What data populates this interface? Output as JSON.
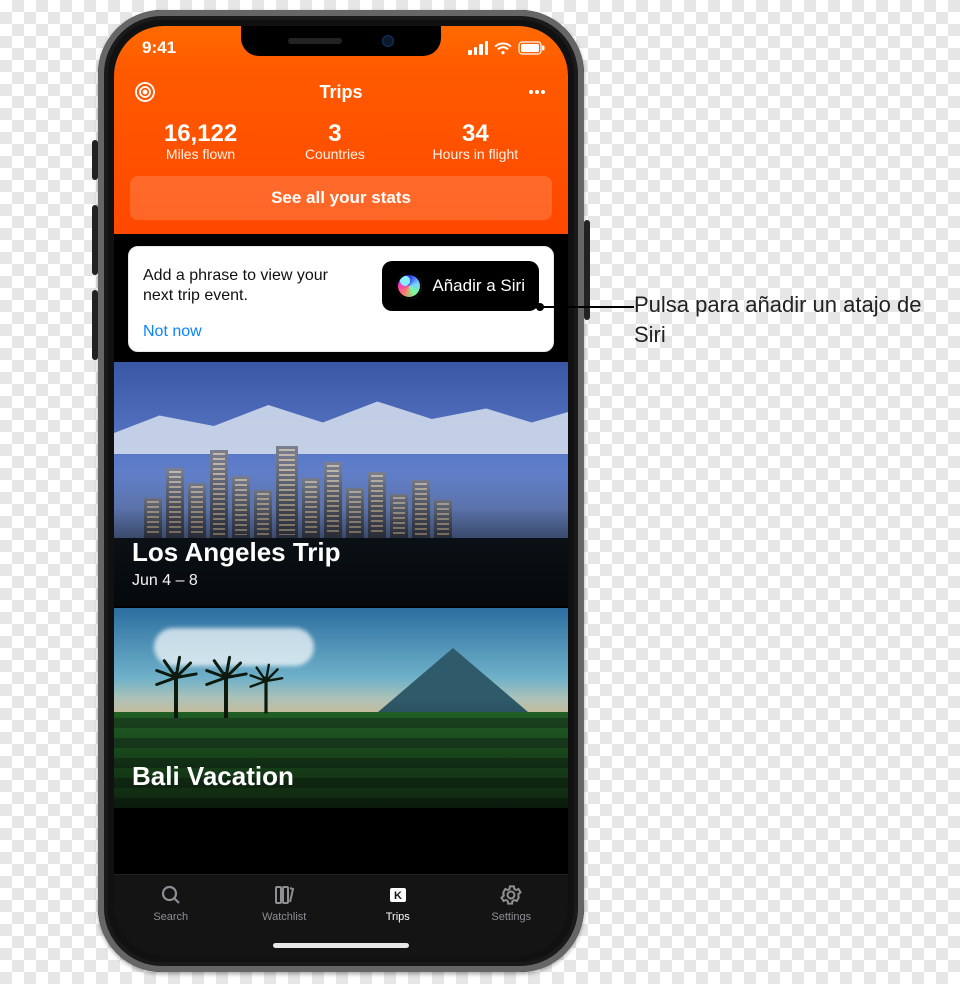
{
  "status": {
    "time": "9:41"
  },
  "nav": {
    "title": "Trips"
  },
  "stats": {
    "items": [
      {
        "value": "16,122",
        "label": "Miles flown"
      },
      {
        "value": "3",
        "label": "Countries"
      },
      {
        "value": "34",
        "label": "Hours in flight"
      }
    ],
    "see_all": "See all your stats"
  },
  "siri": {
    "prompt": "Add a phrase to view your next trip event.",
    "button": "Añadir a Siri",
    "not_now": "Not now"
  },
  "trips": [
    {
      "title": "Los Angeles Trip",
      "subtitle": "Jun 4 – 8"
    },
    {
      "title": "Bali Vacation",
      "subtitle": ""
    }
  ],
  "tabs": [
    {
      "label": "Search"
    },
    {
      "label": "Watchlist"
    },
    {
      "label": "Trips"
    },
    {
      "label": "Settings"
    }
  ],
  "callout": "Pulsa para añadir un atajo de Siri"
}
